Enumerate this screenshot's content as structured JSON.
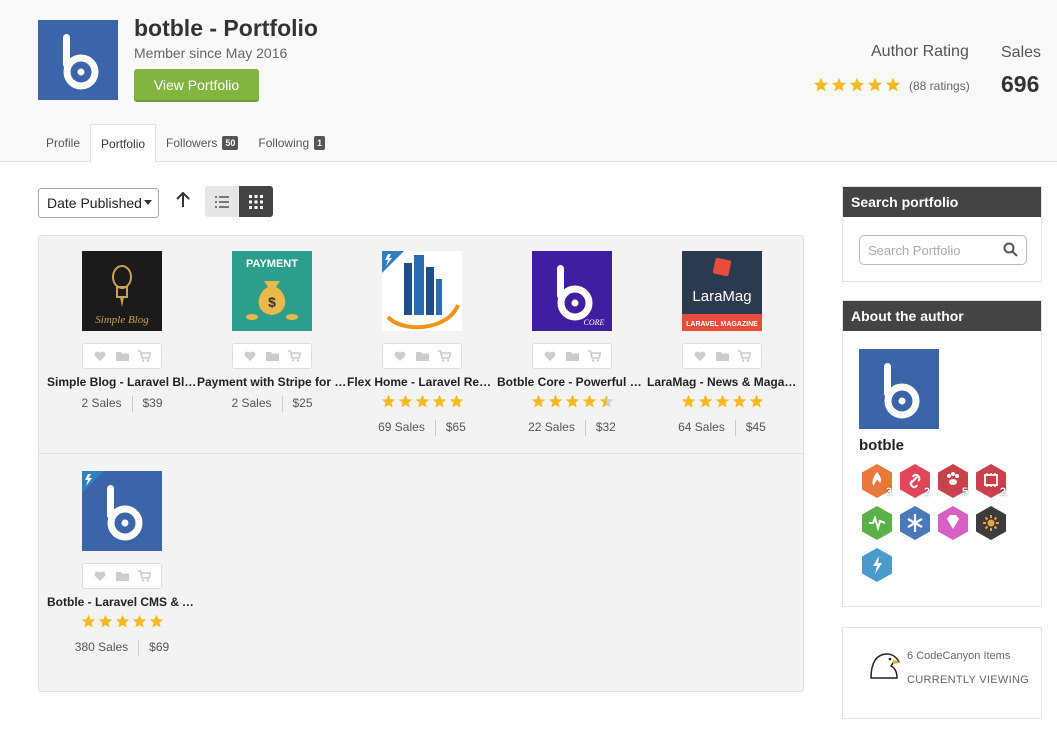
{
  "header": {
    "title": "botble - Portfolio",
    "member_since": "Member since May 2016",
    "view_portfolio_label": "View Portfolio",
    "author_rating_label": "Author Rating",
    "rating_count": "(88 ratings)",
    "rating_value": 5,
    "sales_label": "Sales",
    "sales_value": "696"
  },
  "tabs": [
    {
      "label": "Profile",
      "badge": ""
    },
    {
      "label": "Portfolio",
      "badge": "",
      "active": true
    },
    {
      "label": "Followers",
      "badge": "50"
    },
    {
      "label": "Following",
      "badge": "1"
    }
  ],
  "toolbar": {
    "sort_selected": "Date Published",
    "sort_direction_icon": "arrow-up-icon",
    "view_modes": [
      "list-view-icon",
      "grid-view-icon"
    ],
    "active_view": "grid"
  },
  "items": [
    {
      "name": "Simple Blog - Laravel Blog Script",
      "sales": "2 Sales",
      "price": "$39",
      "rating": null,
      "thumb": "simple-blog"
    },
    {
      "name": "Payment with Stripe for Botble CMS",
      "sales": "2 Sales",
      "price": "$25",
      "rating": null,
      "thumb": "payment"
    },
    {
      "name": "Flex Home - Laravel Real Estate Script",
      "sales": "69 Sales",
      "price": "$65",
      "rating": 5,
      "thumb": "flex-home"
    },
    {
      "name": "Botble Core - Powerful Laravel CMS",
      "sales": "22 Sales",
      "price": "$32",
      "rating": 4.5,
      "thumb": "botble-core"
    },
    {
      "name": "LaraMag - News & Magazine Laravel Script",
      "sales": "64 Sales",
      "price": "$45",
      "rating": 5,
      "thumb": "laramag"
    },
    {
      "name": "Botble - Laravel CMS & Admin Panel",
      "sales": "380 Sales",
      "price": "$69",
      "rating": 5,
      "thumb": "botble"
    }
  ],
  "thumb_text": {
    "simple_blog": "Simple Blog",
    "payment": "PAYMENT",
    "core": "CORE",
    "laramag": "LaraMag",
    "laramag_sub": "LARAVEL MAGAZINE"
  },
  "sidebar": {
    "search_title": "Search portfolio",
    "search_placeholder": "Search Portfolio",
    "about_title": "About the author",
    "author_name": "botble",
    "badges": [
      {
        "icon": "flame-icon",
        "color": "#e8783c",
        "label": "3"
      },
      {
        "icon": "link-icon",
        "color": "#e0475a",
        "label": "2"
      },
      {
        "icon": "paw-icon",
        "color": "#c9414a",
        "label": "5"
      },
      {
        "icon": "chip-icon",
        "color": "#c9414a",
        "label": "2"
      },
      {
        "icon": "pulse-icon",
        "color": "#5bb04a",
        "label": ""
      },
      {
        "icon": "snowflake-icon",
        "color": "#4a78b8",
        "label": ""
      },
      {
        "icon": "gem-icon",
        "color": "#d760c4",
        "label": ""
      },
      {
        "icon": "sun-icon",
        "color": "#3c3c3c",
        "label": ""
      },
      {
        "icon": "bolt-icon",
        "color": "#4a9acb",
        "label": ""
      }
    ],
    "viewing_count": "6 CodeCanyon Items",
    "viewing_caption": "CURRENTLY VIEWING"
  },
  "colors": {
    "brand_blue": "#3c64a8",
    "accent_green": "#82b440",
    "star": "#f5b921",
    "dark_head": "#444444"
  }
}
